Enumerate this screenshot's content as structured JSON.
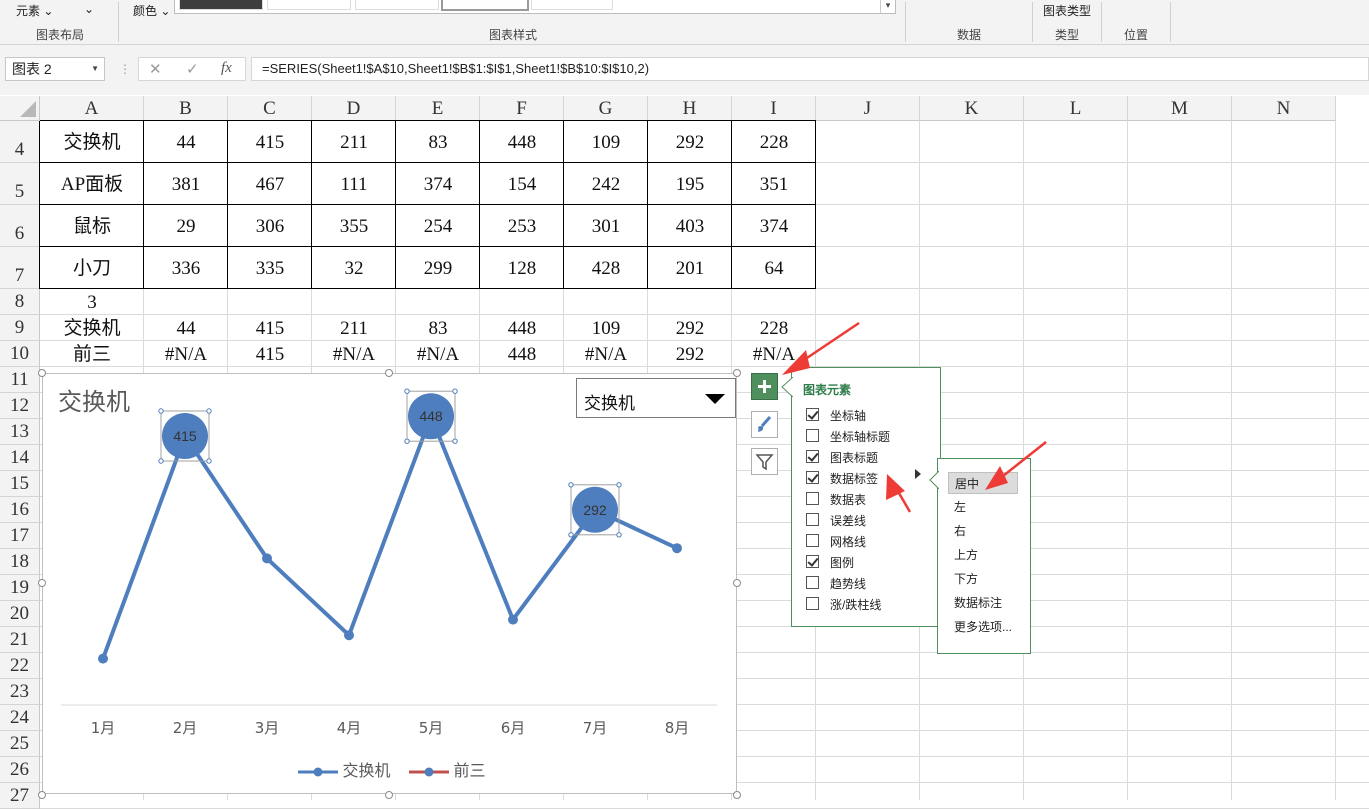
{
  "ribbon": {
    "element_label": "元素",
    "color_label": "颜色",
    "groups": {
      "layout": "图表布局",
      "styles": "图表样式",
      "data": "数据",
      "type": "类型",
      "location": "位置"
    },
    "chart_type_label": "图表类型"
  },
  "formula_bar": {
    "name_box": "图表 2",
    "cancel_icon": "✕",
    "enter_icon": "✓",
    "fx_label": "fx",
    "formula": "=SERIES(Sheet1!$A$10,Sheet1!$B$1:$I$1,Sheet1!$B$10:$I$10,2)"
  },
  "columns": [
    "A",
    "B",
    "C",
    "D",
    "E",
    "F",
    "G",
    "H",
    "I",
    "J",
    "K",
    "L",
    "M",
    "N"
  ],
  "rows": [
    {
      "num": "4",
      "cells": [
        "交换机",
        "44",
        "415",
        "211",
        "83",
        "448",
        "109",
        "292",
        "228"
      ]
    },
    {
      "num": "5",
      "cells": [
        "AP面板",
        "381",
        "467",
        "111",
        "374",
        "154",
        "242",
        "195",
        "351"
      ]
    },
    {
      "num": "6",
      "cells": [
        "鼠标",
        "29",
        "306",
        "355",
        "254",
        "253",
        "301",
        "403",
        "374"
      ]
    },
    {
      "num": "7",
      "cells": [
        "小刀",
        "336",
        "335",
        "32",
        "299",
        "128",
        "428",
        "201",
        "64"
      ]
    },
    {
      "num": "8",
      "cells": [
        "3",
        "",
        "",
        "",
        "",
        "",
        "",
        "",
        ""
      ]
    },
    {
      "num": "9",
      "cells": [
        "交换机",
        "44",
        "415",
        "211",
        "83",
        "448",
        "109",
        "292",
        "228"
      ]
    },
    {
      "num": "10",
      "cells": [
        "前三",
        "#N/A",
        "415",
        "#N/A",
        "#N/A",
        "448",
        "#N/A",
        "292",
        "#N/A"
      ]
    },
    {
      "num": "11",
      "cells": []
    },
    {
      "num": "12",
      "cells": []
    },
    {
      "num": "13",
      "cells": []
    },
    {
      "num": "14",
      "cells": []
    },
    {
      "num": "15",
      "cells": []
    },
    {
      "num": "16",
      "cells": []
    },
    {
      "num": "17",
      "cells": []
    },
    {
      "num": "18",
      "cells": []
    },
    {
      "num": "19",
      "cells": []
    },
    {
      "num": "20",
      "cells": []
    },
    {
      "num": "21",
      "cells": []
    },
    {
      "num": "22",
      "cells": []
    },
    {
      "num": "23",
      "cells": []
    },
    {
      "num": "24",
      "cells": []
    },
    {
      "num": "25",
      "cells": []
    },
    {
      "num": "26",
      "cells": []
    },
    {
      "num": "27",
      "cells": []
    }
  ],
  "chart_data": {
    "type": "line",
    "title": "交换机",
    "categories": [
      "1月",
      "2月",
      "3月",
      "4月",
      "5月",
      "6月",
      "7月",
      "8月"
    ],
    "series": [
      {
        "name": "交换机",
        "values": [
          44,
          415,
          211,
          83,
          448,
          109,
          292,
          228
        ],
        "color": "#4e7ebd"
      },
      {
        "name": "前三",
        "values": [
          null,
          415,
          null,
          null,
          448,
          null,
          292,
          null
        ],
        "color": "#4e7ebd",
        "legend_color": "#c0504d",
        "marker": "large-circle",
        "data_labels": true
      }
    ],
    "ylim": [
      0,
      500
    ],
    "grid": false,
    "legend": "bottom"
  },
  "chart_dropdown": {
    "selected": "交换机"
  },
  "chart_elements_panel": {
    "title": "图表元素",
    "items": [
      {
        "label": "坐标轴",
        "checked": true
      },
      {
        "label": "坐标轴标题",
        "checked": false
      },
      {
        "label": "图表标题",
        "checked": true
      },
      {
        "label": "数据标签",
        "checked": true
      },
      {
        "label": "数据表",
        "checked": false
      },
      {
        "label": "误差线",
        "checked": false
      },
      {
        "label": "网格线",
        "checked": false
      },
      {
        "label": "图例",
        "checked": true
      },
      {
        "label": "趋势线",
        "checked": false
      },
      {
        "label": "涨/跌柱线",
        "checked": false
      }
    ]
  },
  "data_label_submenu": {
    "items": [
      "居中",
      "左",
      "右",
      "上方",
      "下方",
      "数据标注",
      "更多选项..."
    ],
    "selected": "居中"
  },
  "annotation_color": "#ef3b36",
  "accent_green": "#2e7d4b"
}
